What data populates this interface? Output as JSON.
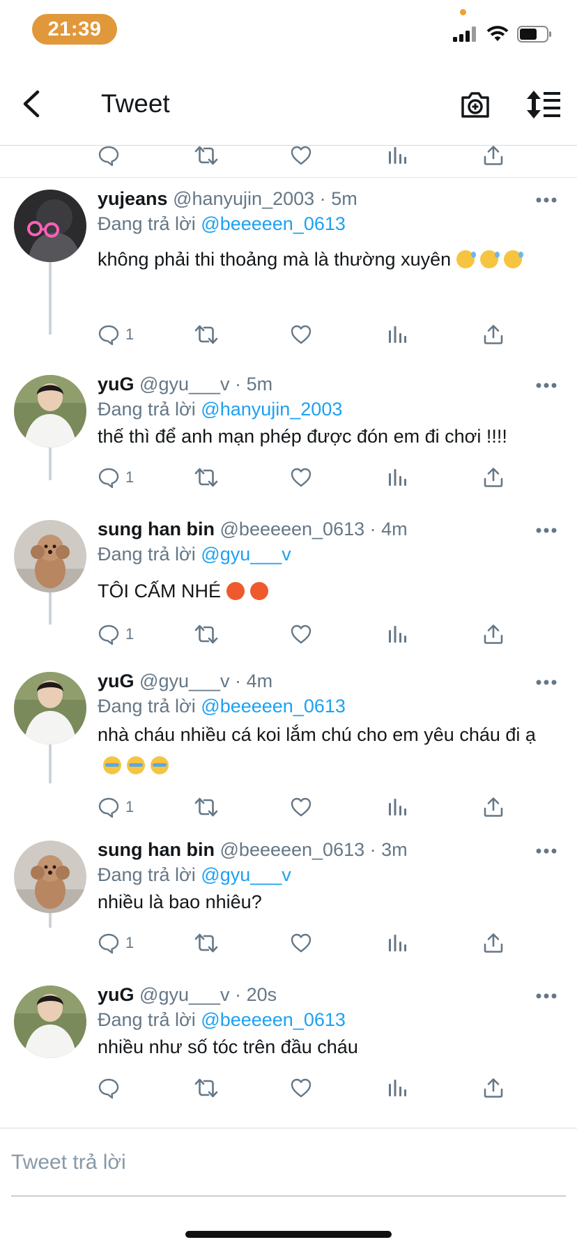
{
  "status_bar": {
    "time": "21:39",
    "battery_level": 0.65
  },
  "nav": {
    "title": "Tweet",
    "back_icon": "chevron-left-icon",
    "camera_icon": "camera-plus-icon",
    "sort_icon": "sort-lines-icon"
  },
  "tweets": [
    {
      "name": "yujeans",
      "handle": "@hanyujin_2003",
      "time": "5m",
      "reply_prefix": "Đang trả lời",
      "reply_to": "@beeeeen_0613",
      "body": "không phải thi thoảng mà là thường xuyên",
      "emojis": [
        "grinning-sweat",
        "grinning-sweat",
        "grinning-sweat"
      ],
      "reply_count": "1"
    },
    {
      "name": "yuG",
      "handle": "@gyu___v",
      "time": "5m",
      "reply_prefix": "Đang trả lời",
      "reply_to": "@hanyujin_2003",
      "body": "thế thì để anh mạn phép được đón em đi chơi !!!!",
      "emojis": [],
      "reply_count": "1"
    },
    {
      "name": "sung han bin",
      "handle": "@beeeeen_0613",
      "time": "4m",
      "reply_prefix": "Đang trả lời",
      "reply_to": "@gyu___v",
      "body": "TÔI CẤM NHÉ",
      "emojis": [
        "angry",
        "angry"
      ],
      "reply_count": "1"
    },
    {
      "name": "yuG",
      "handle": "@gyu___v",
      "time": "4m",
      "reply_prefix": "Đang trả lời",
      "reply_to": "@beeeeen_0613",
      "body": "nhà cháu nhiều cá koi lắm chú cho em yêu cháu đi ạ",
      "emojis": [
        "crying",
        "crying",
        "crying"
      ],
      "reply_count": "1"
    },
    {
      "name": "sung han bin",
      "handle": "@beeeeen_0613",
      "time": "3m",
      "reply_prefix": "Đang trả lời",
      "reply_to": "@gyu___v",
      "body": "nhiều là bao nhiêu?",
      "emojis": [],
      "reply_count": "1"
    },
    {
      "name": "yuG",
      "handle": "@gyu___v",
      "time": "20s",
      "reply_prefix": "Đang trả lời",
      "reply_to": "@beeeeen_0613",
      "body": "nhiều như số tóc trên đầu cháu",
      "emojis": [],
      "reply_count": ""
    }
  ],
  "reply_bar": {
    "placeholder": "Tweet trả lời"
  },
  "colors": {
    "accent": "#1da1f2",
    "time_pill": "#e0983a",
    "secondary_text": "#657786"
  },
  "action_icons": [
    "reply-icon",
    "retweet-icon",
    "like-icon",
    "analytics-icon",
    "share-icon"
  ]
}
